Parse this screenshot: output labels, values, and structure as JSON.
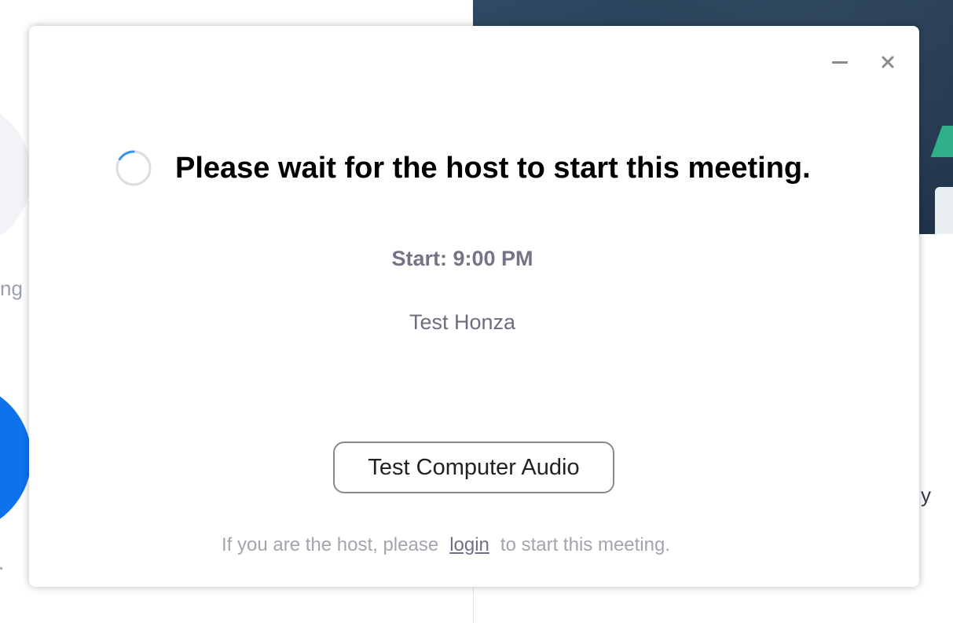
{
  "background": {
    "home_text_fragment": "ng",
    "right_fragment": "y"
  },
  "dialog": {
    "window_controls": {
      "minimize_icon": "minimize-icon",
      "close_icon": "close-icon",
      "close_glyph": "×"
    },
    "status_icon": "loading-spinner-icon",
    "title": "Please wait for the host to start this meeting.",
    "start_time": "Start: 9:00 PM",
    "meeting_name": "Test Honza",
    "test_audio_button": "Test Computer Audio",
    "footer": {
      "prefix": "If you are the host, please",
      "link": "login",
      "suffix": "to start this meeting."
    }
  },
  "colors": {
    "accent_blue": "#0e72ed",
    "title_text": "#000000",
    "muted_text": "#747487",
    "footer_text": "#a4a4ad"
  }
}
